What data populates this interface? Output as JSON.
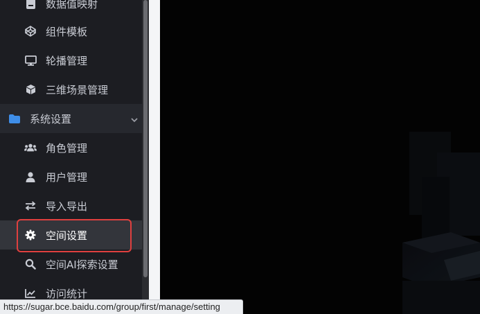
{
  "sidebar": {
    "items": [
      {
        "label": "数据值映射",
        "icon": "database-icon"
      },
      {
        "label": "组件模板",
        "icon": "codepen-icon"
      },
      {
        "label": "轮播管理",
        "icon": "desktop-icon"
      },
      {
        "label": "三维场景管理",
        "icon": "cube-icon"
      }
    ],
    "group": {
      "label": "系统设置",
      "icon": "folder-icon",
      "expanded": true
    },
    "sub_items": [
      {
        "label": "角色管理",
        "icon": "users-icon"
      },
      {
        "label": "用户管理",
        "icon": "user-icon"
      },
      {
        "label": "导入导出",
        "icon": "exchange-icon"
      },
      {
        "label": "空间设置",
        "icon": "gear-icon",
        "active": true
      },
      {
        "label": "空间AI探索设置",
        "icon": "search-icon"
      },
      {
        "label": "访问统计",
        "icon": "line-chart-icon"
      }
    ]
  },
  "status_bar": {
    "url": "https://sugar.bce.baidu.com/group/first/manage/setting"
  },
  "colors": {
    "sidebar_bg": "#1c1d22",
    "group_bg": "#26282e",
    "active_bg": "#33353b",
    "folder_blue": "#3f8ee8",
    "highlight_red": "#e0403f"
  }
}
